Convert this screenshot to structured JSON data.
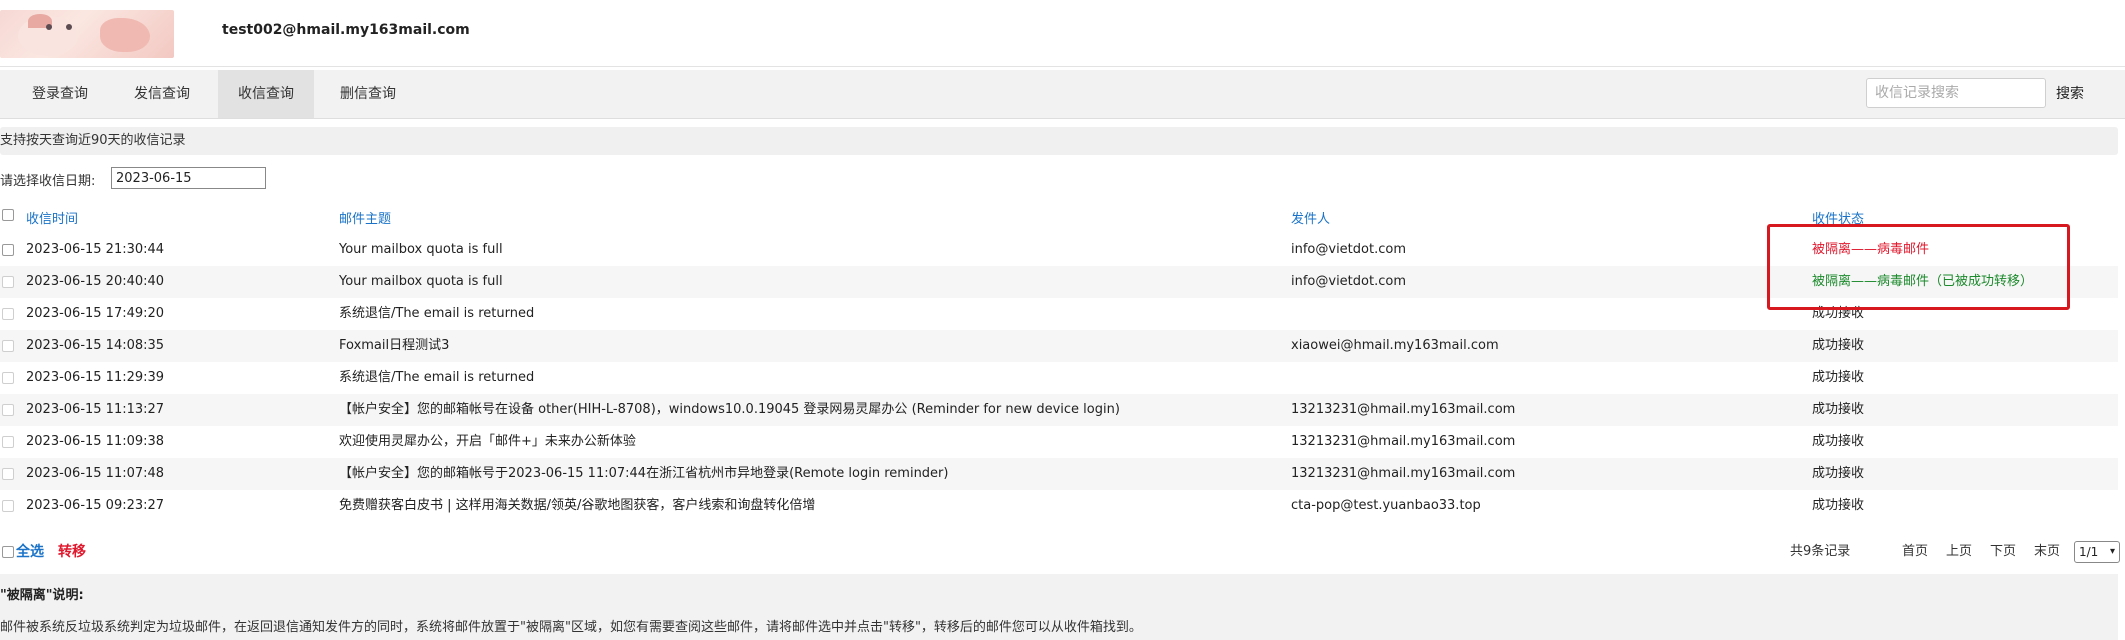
{
  "header": {
    "user_email": "test002@hmail.my163mail.com"
  },
  "tabs": [
    {
      "label": "登录查询",
      "active": false
    },
    {
      "label": "发信查询",
      "active": false
    },
    {
      "label": "收信查询",
      "active": true
    },
    {
      "label": "删信查询",
      "active": false
    }
  ],
  "search": {
    "placeholder": "收信记录搜索",
    "button_label": "搜索"
  },
  "info_text": "支持按天查询近90天的收信记录",
  "date_filter": {
    "label": "请选择收信日期:",
    "value": "2023-06-15"
  },
  "table": {
    "columns": [
      "收信时间",
      "邮件主题",
      "发件人",
      "收件状态"
    ],
    "rows": [
      {
        "time": "2023-06-15 21:30:44",
        "subject": "Your mailbox quota is full",
        "sender": "info@vietdot.com",
        "status": "被隔离——病毒邮件",
        "status_color": "#e0182d"
      },
      {
        "time": "2023-06-15 20:40:40",
        "subject": "Your mailbox quota is full",
        "sender": "info@vietdot.com",
        "status": "被隔离——病毒邮件（已被成功转移）",
        "status_color": "#1c8a2c"
      },
      {
        "time": "2023-06-15 17:49:20",
        "subject": "系统退信/The email is returned",
        "sender": "",
        "status": "成功接收",
        "status_color": "#222222"
      },
      {
        "time": "2023-06-15 14:08:35",
        "subject": "Foxmail日程测试3",
        "sender": "xiaowei@hmail.my163mail.com",
        "status": "成功接收",
        "status_color": "#222222"
      },
      {
        "time": "2023-06-15 11:29:39",
        "subject": "系统退信/The email is returned",
        "sender": "",
        "status": "成功接收",
        "status_color": "#222222"
      },
      {
        "time": "2023-06-15 11:13:27",
        "subject": "【帐户安全】您的邮箱帐号在设备 other(HIH-L-8708)，windows10.0.19045 登录网易灵犀办公 (Reminder for new device login)",
        "sender": "13213231@hmail.my163mail.com",
        "status": "成功接收",
        "status_color": "#222222"
      },
      {
        "time": "2023-06-15 11:09:38",
        "subject": "欢迎使用灵犀办公，开启「邮件+」未来办公新体验",
        "sender": "13213231@hmail.my163mail.com",
        "status": "成功接收",
        "status_color": "#222222"
      },
      {
        "time": "2023-06-15 11:07:48",
        "subject": "【帐户安全】您的邮箱帐号于2023-06-15 11:07:44在浙江省杭州市异地登录(Remote login reminder)",
        "sender": "13213231@hmail.my163mail.com",
        "status": "成功接收",
        "status_color": "#222222"
      },
      {
        "time": "2023-06-15 09:23:27",
        "subject": "免费赠获客白皮书 | 这样用海关数据/领英/谷歌地图获客，客户线索和询盘转化倍增",
        "sender": "cta-pop@test.yuanbao33.top",
        "status": "成功接收",
        "status_color": "#222222"
      }
    ]
  },
  "footer": {
    "select_all": "全选",
    "transfer": "转移",
    "total": "共9条记录",
    "first": "首页",
    "prev": "上页",
    "next": "下页",
    "last": "末页",
    "page_select": "1/1"
  },
  "note": {
    "title": "\"被隔离\"说明:",
    "text": "邮件被系统反垃圾系统判定为垃圾邮件，在返回退信通知发件方的同时，系统将邮件放置于\"被隔离\"区域，如您有需要查阅这些邮件，请将邮件选中并点击\"转移\"，转移后的邮件您可以从收件箱找到。"
  }
}
